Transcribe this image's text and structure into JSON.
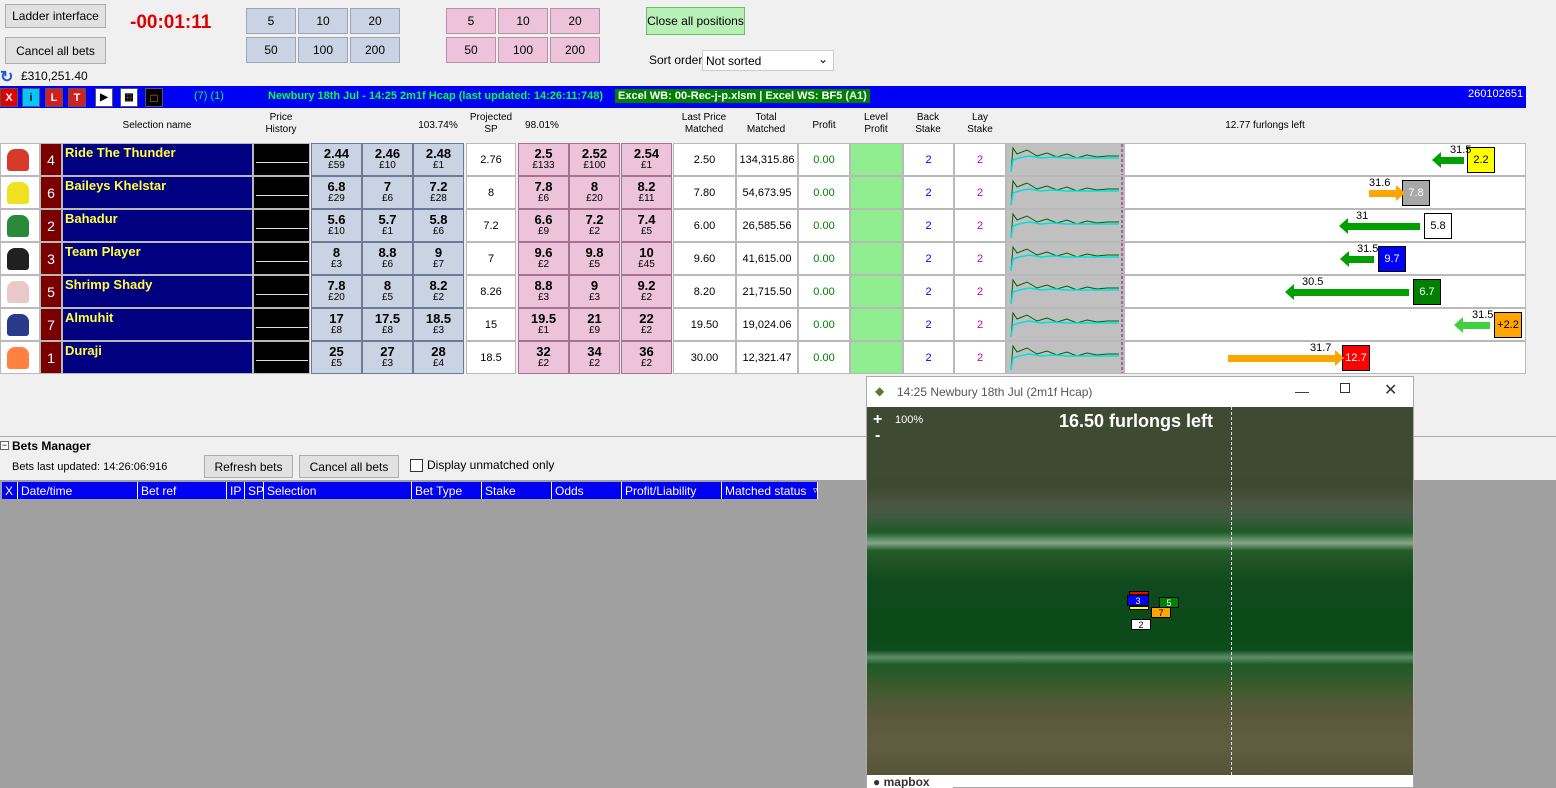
{
  "toolbar": {
    "ladder_interface": "Ladder interface",
    "cancel_all_bets": "Cancel all bets",
    "timer": "-00:01:11",
    "balance": "£310,251.40",
    "back_stakes": [
      "5",
      "10",
      "20",
      "50",
      "100",
      "200"
    ],
    "lay_stakes": [
      "5",
      "10",
      "20",
      "50",
      "100",
      "200"
    ],
    "close_all_positions": "Close all positions",
    "sort_order_label": "Sort order",
    "sort_order_value": "Not sorted",
    "icons": [
      "X",
      "i",
      "L",
      "T"
    ]
  },
  "market_bar": {
    "counts": "(7) (1)",
    "title": "Newbury 18th Jul - 14:25 2m1f Hcap (last updated: 14:26:11:748)",
    "excel": "Excel WB: 00-Rec-j-p.xlsm | Excel WS: BF5 (A1)",
    "market_id": "260102651"
  },
  "headers": {
    "selection_name": "Selection name",
    "price_history": "Price\nHistory",
    "back_book": "103.74%",
    "projected_sp": "Projected\nSP",
    "lay_book": "98.01%",
    "last_price_matched": "Last Price\nMatched",
    "total_matched": "Total\nMatched",
    "profit": "Profit",
    "level_profit": "Level\nProfit",
    "back_stake": "Back\nStake",
    "lay_stake": "Lay\nStake",
    "furlongs_left": "12.77 furlongs left"
  },
  "runners": [
    {
      "num": "4",
      "name": "Ride The Thunder",
      "silk": "#d83a2a",
      "backs": [
        [
          "2.44",
          "£59"
        ],
        [
          "2.46",
          "£10"
        ],
        [
          "2.48",
          "£1"
        ]
      ],
      "sp": "2.76",
      "lays": [
        [
          "2.5",
          "£133"
        ],
        [
          "2.52",
          "£100"
        ],
        [
          "2.54",
          "£1"
        ]
      ],
      "lpm": "2.50",
      "total": "134,315.86",
      "profit": "0.00",
      "back_stake": "2",
      "lay_stake": "2",
      "tag_text": "2.2",
      "tag_color": "#ffff00",
      "tag_text_color": "#000",
      "arrow_label": "31.5",
      "arrow_color": "#00a000",
      "arrow_dir": "left"
    },
    {
      "num": "6",
      "name": "Baileys Khelstar",
      "silk": "#f0e020",
      "backs": [
        [
          "6.8",
          "£29"
        ],
        [
          "7",
          "£6"
        ],
        [
          "7.2",
          "£28"
        ]
      ],
      "sp": "8",
      "lays": [
        [
          "7.8",
          "£6"
        ],
        [
          "8",
          "£20"
        ],
        [
          "8.2",
          "£11"
        ]
      ],
      "lpm": "7.80",
      "total": "54,673.95",
      "profit": "0.00",
      "back_stake": "2",
      "lay_stake": "2",
      "tag_text": "7.8",
      "tag_color": "#a8a8a8",
      "tag_text_color": "#fff",
      "arrow_label": "31.6",
      "arrow_color": "#ffa500",
      "arrow_dir": "right"
    },
    {
      "num": "2",
      "name": "Bahadur",
      "silk": "#2a8a3a",
      "backs": [
        [
          "5.6",
          "£10"
        ],
        [
          "5.7",
          "£1"
        ],
        [
          "5.8",
          "£6"
        ]
      ],
      "sp": "7.2",
      "lays": [
        [
          "6.6",
          "£9"
        ],
        [
          "7.2",
          "£2"
        ],
        [
          "7.4",
          "£5"
        ]
      ],
      "lpm": "6.00",
      "total": "26,585.56",
      "profit": "0.00",
      "back_stake": "2",
      "lay_stake": "2",
      "tag_text": "5.8",
      "tag_color": "#ffffff",
      "tag_text_color": "#000",
      "arrow_label": "31",
      "arrow_color": "#00a000",
      "arrow_dir": "left"
    },
    {
      "num": "3",
      "name": "Team Player",
      "silk": "#202020",
      "backs": [
        [
          "8",
          "£3"
        ],
        [
          "8.8",
          "£6"
        ],
        [
          "9",
          "£7"
        ]
      ],
      "sp": "7",
      "lays": [
        [
          "9.6",
          "£2"
        ],
        [
          "9.8",
          "£5"
        ],
        [
          "10",
          "£45"
        ]
      ],
      "lpm": "9.60",
      "total": "41,615.00",
      "profit": "0.00",
      "back_stake": "2",
      "lay_stake": "2",
      "tag_text": "9.7",
      "tag_color": "#0000ff",
      "tag_text_color": "#fff",
      "arrow_label": "31.5",
      "arrow_color": "#00a000",
      "arrow_dir": "left"
    },
    {
      "num": "5",
      "name": "Shrimp Shady",
      "silk": "#e8c8c8",
      "backs": [
        [
          "7.8",
          "£20"
        ],
        [
          "8",
          "£5"
        ],
        [
          "8.2",
          "£2"
        ]
      ],
      "sp": "8.26",
      "lays": [
        [
          "8.8",
          "£3"
        ],
        [
          "9",
          "£3"
        ],
        [
          "9.2",
          "£2"
        ]
      ],
      "lpm": "8.20",
      "total": "21,715.50",
      "profit": "0.00",
      "back_stake": "2",
      "lay_stake": "2",
      "tag_text": "6.7",
      "tag_color": "#008000",
      "tag_text_color": "#fff",
      "arrow_label": "30.5",
      "arrow_color": "#00a000",
      "arrow_dir": "left"
    },
    {
      "num": "7",
      "name": "Almuhit",
      "silk": "#2a3a8a",
      "backs": [
        [
          "17",
          "£8"
        ],
        [
          "17.5",
          "£8"
        ],
        [
          "18.5",
          "£3"
        ]
      ],
      "sp": "15",
      "lays": [
        [
          "19.5",
          "£1"
        ],
        [
          "21",
          "£9"
        ],
        [
          "22",
          "£2"
        ]
      ],
      "lpm": "19.50",
      "total": "19,024.06",
      "profit": "0.00",
      "back_stake": "2",
      "lay_stake": "2",
      "tag_text": "+2.2",
      "tag_color": "#ffa500",
      "tag_text_color": "#000",
      "arrow_label": "31.5",
      "arrow_color": "#40d040",
      "arrow_dir": "left"
    },
    {
      "num": "1",
      "name": "Duraji",
      "silk": "#ff8040",
      "backs": [
        [
          "25",
          "£5"
        ],
        [
          "27",
          "£3"
        ],
        [
          "28",
          "£4"
        ]
      ],
      "sp": "18.5",
      "lays": [
        [
          "32",
          "£2"
        ],
        [
          "34",
          "£2"
        ],
        [
          "36",
          "£2"
        ]
      ],
      "lpm": "30.00",
      "total": "12,321.47",
      "profit": "0.00",
      "back_stake": "2",
      "lay_stake": "2",
      "tag_text": "12.7",
      "tag_color": "#ff0000",
      "tag_text_color": "#fff",
      "arrow_label": "31.7",
      "arrow_color": "#ffa500",
      "arrow_dir": "right"
    }
  ],
  "bets_manager": {
    "title": "Bets Manager",
    "last_updated": "Bets last updated: 14:26:06:916",
    "refresh": "Refresh bets",
    "cancel_all": "Cancel all bets",
    "display_unmatched": "Display unmatched only",
    "columns": [
      "X",
      "Date/time",
      "Bet ref",
      "IP",
      "SP",
      "Selection",
      "Bet Type",
      "Stake",
      "Odds",
      "Profit/Liability",
      "Matched status"
    ]
  },
  "map_window": {
    "title": "14:25 Newbury 18th Jul (2m1f Hcap)",
    "zoom": "100%",
    "furlongs": "16.50 furlongs left",
    "logo": "mapbox",
    "zoom_in": "+",
    "zoom_out": "-",
    "markers": [
      "3",
      "5",
      "7",
      "2"
    ]
  }
}
